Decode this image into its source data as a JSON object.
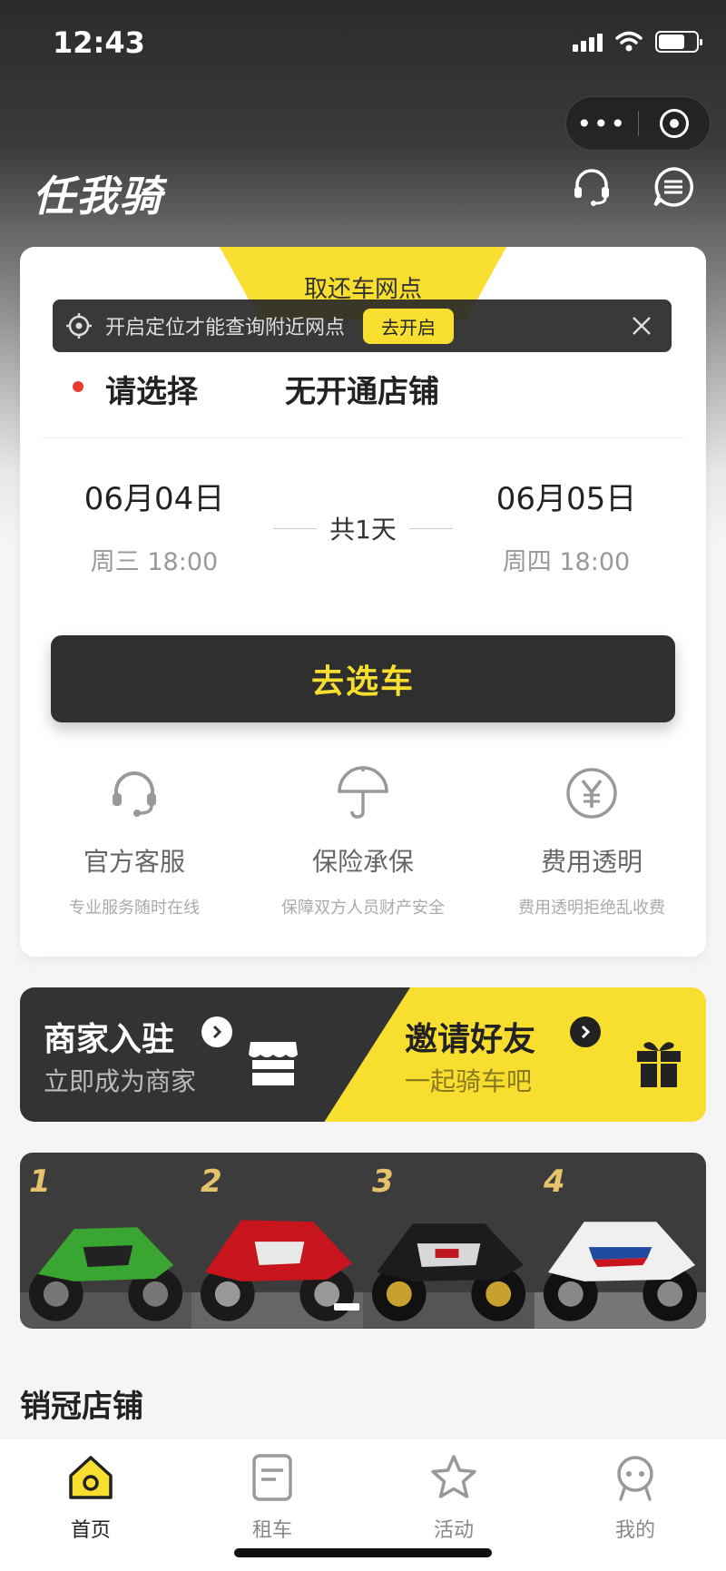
{
  "status_bar": {
    "time": "12:43"
  },
  "header": {
    "logo": "任我骑"
  },
  "capsule": {
    "more": "•••"
  },
  "card": {
    "tab_label": "取还车网点",
    "location_banner": {
      "text": "开启定位才能查询附近网点",
      "button": "去开启"
    },
    "city": "请选择",
    "store": "无开通店铺",
    "start": {
      "date": "06月04日",
      "weekday_time": "周三 18:00"
    },
    "end": {
      "date": "06月05日",
      "weekday_time": "周四 18:00"
    },
    "duration": "共1天",
    "cta": "去选车",
    "features": [
      {
        "icon": "headset-icon",
        "title": "官方客服",
        "desc": "专业服务随时在线"
      },
      {
        "icon": "umbrella-icon",
        "title": "保险承保",
        "desc": "保障双方人员财产安全"
      },
      {
        "icon": "yen-icon",
        "title": "费用透明",
        "desc": "费用透明拒绝乱收费"
      }
    ]
  },
  "promo": {
    "merchant": {
      "title": "商家入驻",
      "subtitle": "立即成为商家"
    },
    "invite": {
      "title": "邀请好友",
      "subtitle": "一起骑车吧"
    }
  },
  "banner": {
    "numbers": [
      "1",
      "2",
      "3",
      "4"
    ]
  },
  "section": {
    "title": "销冠店铺"
  },
  "tabbar": [
    {
      "label": "首页",
      "icon": "home-icon",
      "active": true
    },
    {
      "label": "租车",
      "icon": "document-icon",
      "active": false
    },
    {
      "label": "活动",
      "icon": "star-icon",
      "active": false
    },
    {
      "label": "我的",
      "icon": "user-icon",
      "active": false
    }
  ],
  "colors": {
    "accent": "#f8de2f",
    "dark": "#2f2f2f",
    "dot": "#e83b2e"
  }
}
